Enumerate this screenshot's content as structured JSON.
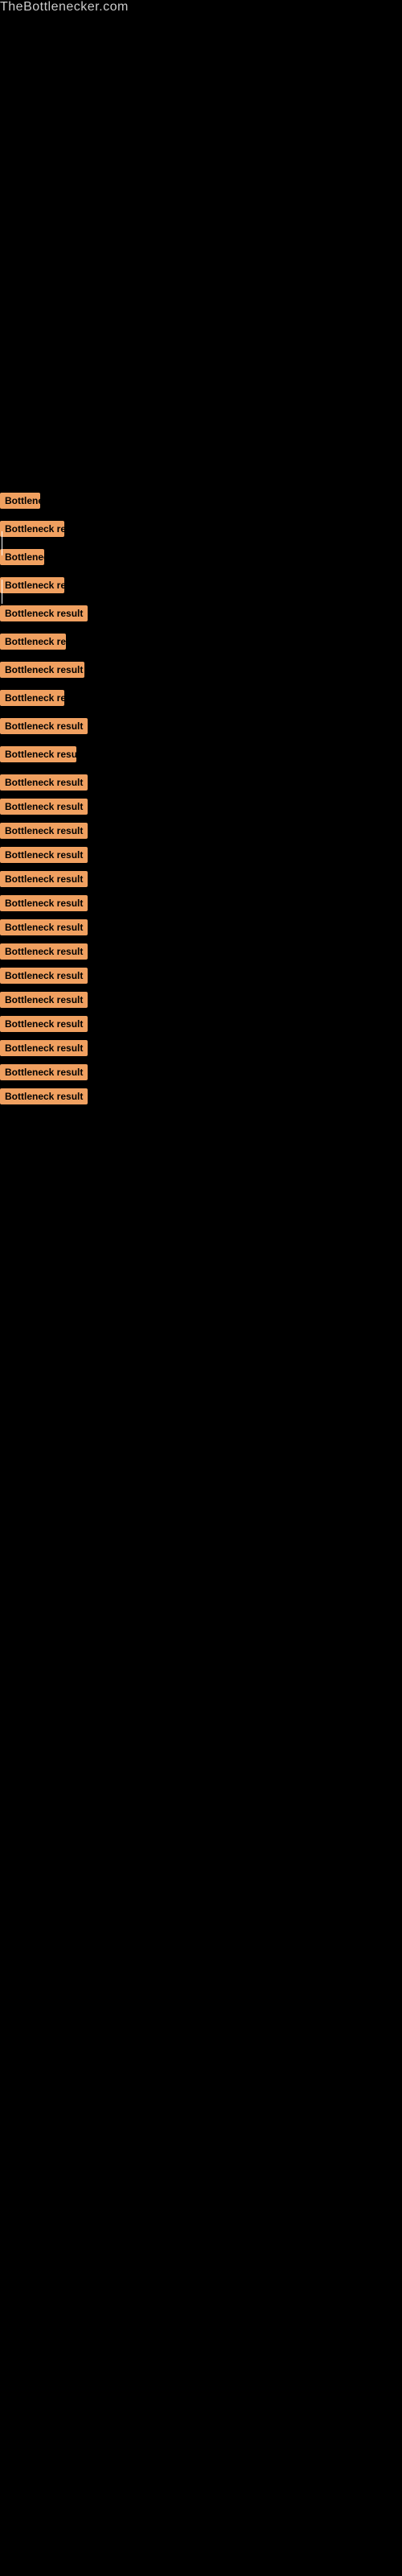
{
  "site": {
    "title": "TheBottlenecker.com"
  },
  "items": [
    {
      "id": 1,
      "label": "Bottleneck result"
    },
    {
      "id": 2,
      "label": "Bottleneck result"
    },
    {
      "id": 3,
      "label": "Bottleneck result"
    },
    {
      "id": 4,
      "label": "Bottleneck result"
    },
    {
      "id": 5,
      "label": "Bottleneck result"
    },
    {
      "id": 6,
      "label": "Bottleneck result"
    },
    {
      "id": 7,
      "label": "Bottleneck result"
    },
    {
      "id": 8,
      "label": "Bottleneck result"
    },
    {
      "id": 9,
      "label": "Bottleneck result"
    },
    {
      "id": 10,
      "label": "Bottleneck result"
    },
    {
      "id": 11,
      "label": "Bottleneck result"
    },
    {
      "id": 12,
      "label": "Bottleneck result"
    },
    {
      "id": 13,
      "label": "Bottleneck result"
    },
    {
      "id": 14,
      "label": "Bottleneck result"
    },
    {
      "id": 15,
      "label": "Bottleneck result"
    },
    {
      "id": 16,
      "label": "Bottleneck result"
    },
    {
      "id": 17,
      "label": "Bottleneck result"
    },
    {
      "id": 18,
      "label": "Bottleneck result"
    },
    {
      "id": 19,
      "label": "Bottleneck result"
    },
    {
      "id": 20,
      "label": "Bottleneck result"
    },
    {
      "id": 21,
      "label": "Bottleneck result"
    },
    {
      "id": 22,
      "label": "Bottleneck result"
    },
    {
      "id": 23,
      "label": "Bottleneck result"
    },
    {
      "id": 24,
      "label": "Bottleneck result"
    }
  ]
}
